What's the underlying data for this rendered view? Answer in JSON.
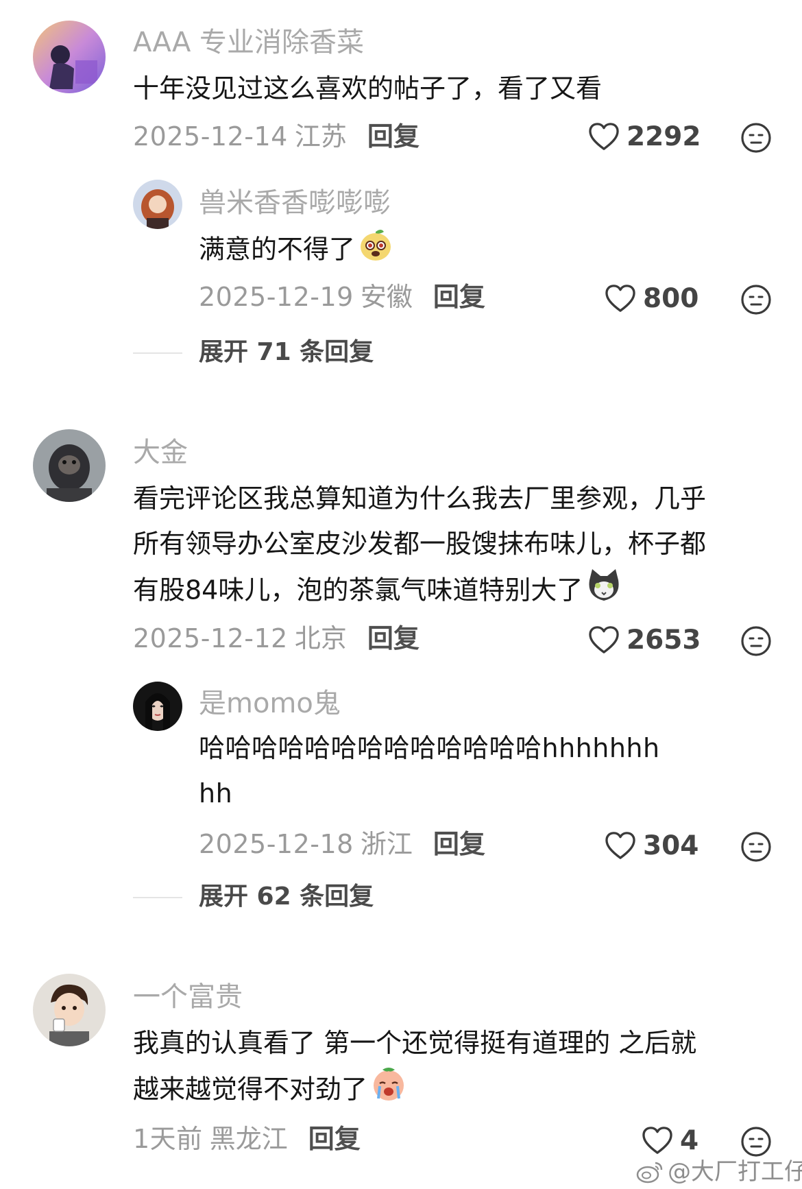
{
  "comments": [
    {
      "username": "AAA 专业消除香菜",
      "text": "十年没见过这么喜欢的帖子了，看了又看",
      "date": "2025-12-14",
      "region": "江苏",
      "reply_label": "回复",
      "likes": "2292",
      "replies": [
        {
          "username": "兽米香香嘭嘭嘭",
          "text": "满意的不得了",
          "emoji": "pear-face-emoji",
          "date": "2025-12-19",
          "region": "安徽",
          "reply_label": "回复",
          "likes": "800"
        }
      ],
      "expand_label": "展开 71 条回复"
    },
    {
      "username": "大金",
      "text_lines": [
        "看完评论区我总算知道为什么我去厂里参观，几乎",
        "所有领导办公室皮沙发都一股馊抹布味儿，杯子都",
        "有股84味儿，泡的茶氯气味道特别大了"
      ],
      "emoji": "cat-emoji",
      "date": "2025-12-12",
      "region": "北京",
      "reply_label": "回复",
      "likes": "2653",
      "replies": [
        {
          "username": "是momo鬼",
          "text_lines": [
            "哈哈哈哈哈哈哈哈哈哈哈哈哈hhhhhhh",
            "hh"
          ],
          "date": "2025-12-18",
          "region": "浙江",
          "reply_label": "回复",
          "likes": "304"
        }
      ],
      "expand_label": "展开 62 条回复"
    },
    {
      "username": "一个富贵",
      "text_lines": [
        "我真的认真看了 第一个还觉得挺有道理的 之后就",
        "越来越觉得不对劲了"
      ],
      "emoji": "crying-face-emoji",
      "date": "1天前",
      "region": "黑龙江",
      "reply_label": "回复",
      "likes": "4"
    }
  ],
  "watermark": "@大厂打工仔",
  "colors": {
    "username": "#a9a9a9",
    "body": "#161616",
    "meta": "#9a9a9a"
  }
}
